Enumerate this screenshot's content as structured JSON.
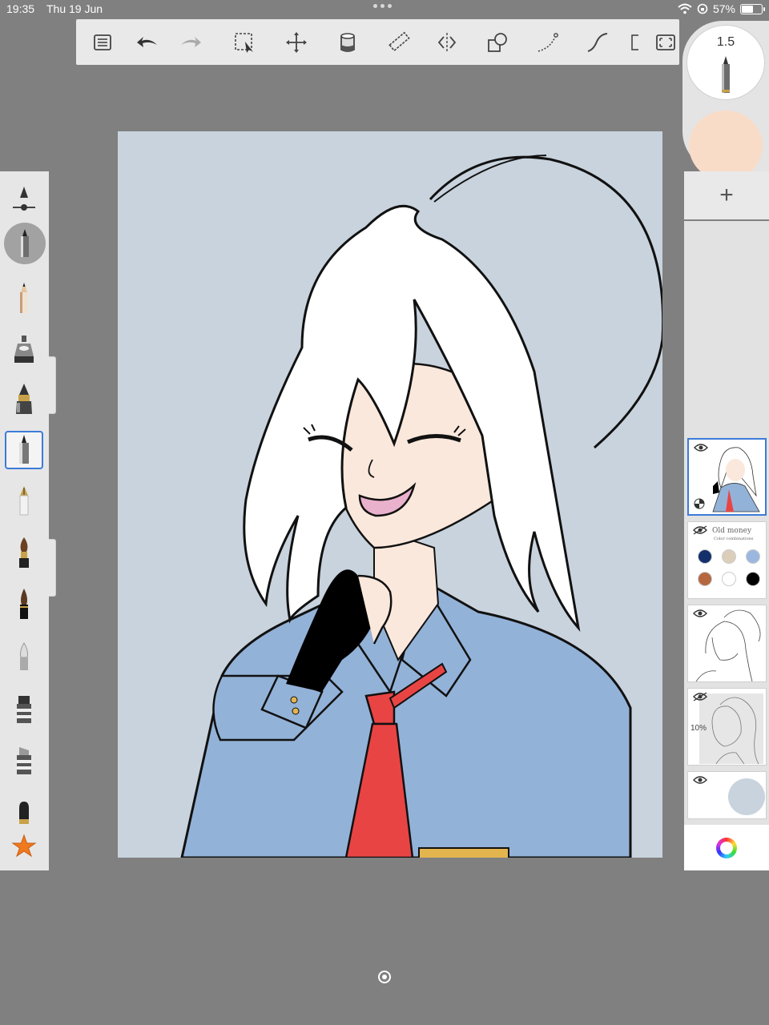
{
  "status_bar": {
    "time": "19:35",
    "date": "Thu 19 Jun",
    "battery": "57%",
    "battery_level": 0.57
  },
  "toolbar": {
    "buttons": [
      "list-icon",
      "undo-icon",
      "redo-icon",
      "selection-icon",
      "transform-icon",
      "fill-icon",
      "ruler-icon",
      "symmetry-icon",
      "shape-icon",
      "stroke-icon",
      "curve-icon",
      "perspective-icon",
      "fullscreen-icon"
    ]
  },
  "brush": {
    "size": "1.5",
    "current_color": "#f9dcc8"
  },
  "brush_palette": {
    "items": [
      "pencil",
      "airbrush",
      "paintbrush",
      "ballpoint-pen",
      "fountain-pen",
      "paint-brush",
      "ink-brush",
      "smudge",
      "marker",
      "chisel-marker",
      "eraser",
      "favorite-star"
    ],
    "selected": "ballpoint-pen"
  },
  "layers": {
    "add_label": "+",
    "palette_note_title": "Old money",
    "palette_note_subtitle": "Color combinations",
    "sketch_opacity_label": "10%",
    "palette_colors": [
      "#14306b",
      "#dccfba",
      "#9bb7df",
      "#b5683f",
      "#ffffff",
      "#000000"
    ],
    "background_color": "#c8d3dd"
  },
  "colors": {
    "canvas_bg": "#c8d3dd",
    "shirt": "#93b2d8",
    "tie": "#e94444",
    "skin": "#fbe8dc",
    "selection_accent": "#3d7bd8"
  }
}
